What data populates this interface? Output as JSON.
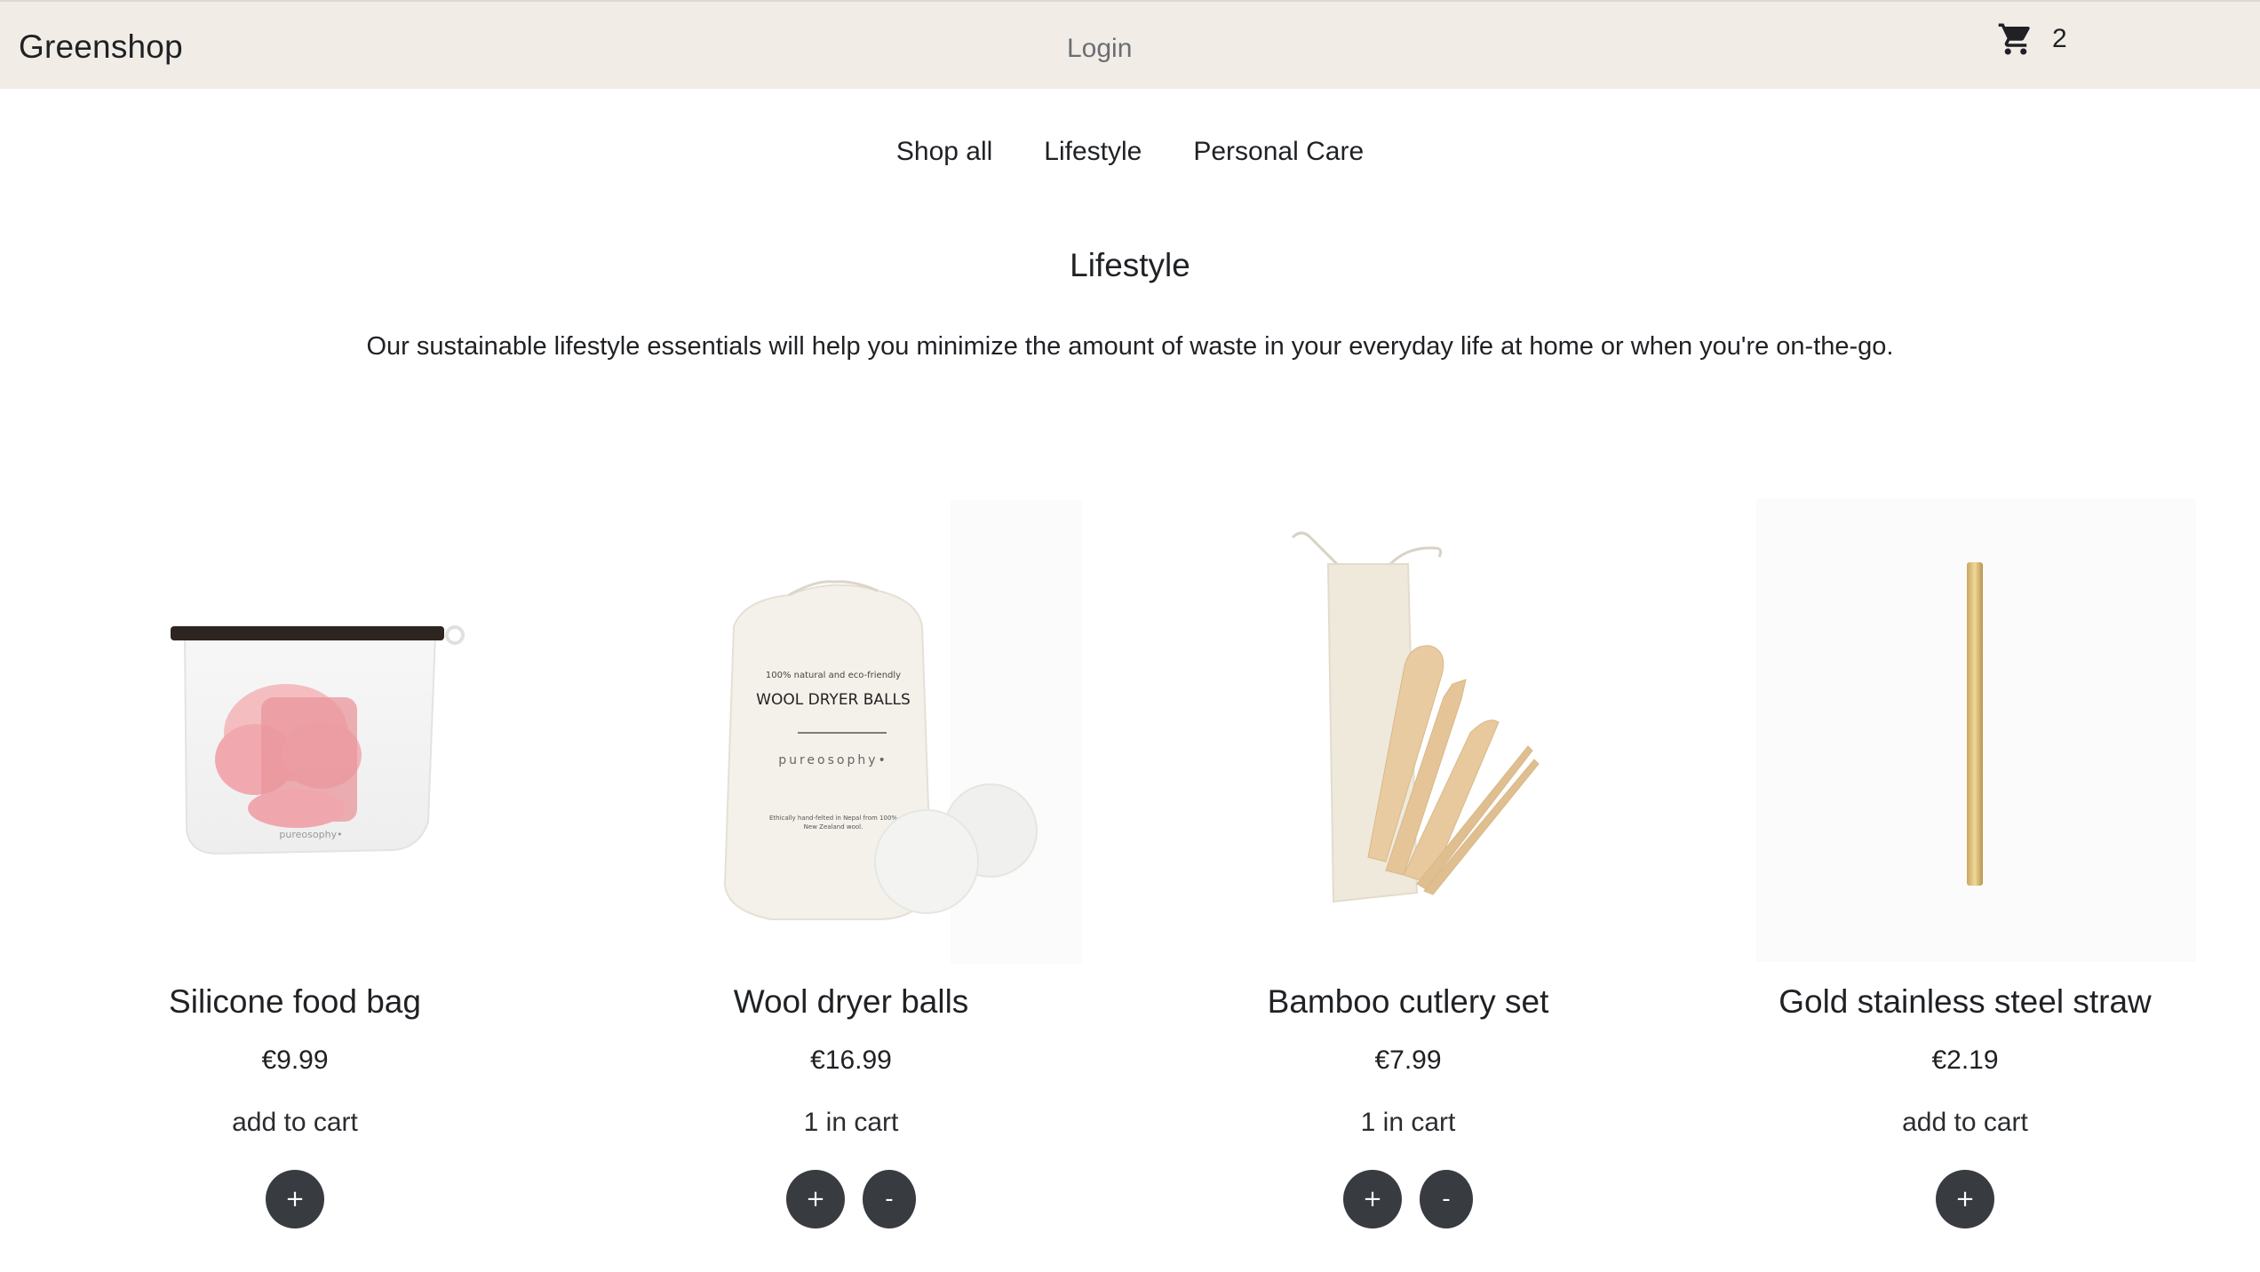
{
  "header": {
    "brand": "Greenshop",
    "login_label": "Login",
    "cart_icon": "shopping-cart-icon",
    "cart_count": "2"
  },
  "nav": {
    "items": [
      {
        "label": "Shop all"
      },
      {
        "label": "Lifestyle"
      },
      {
        "label": "Personal Care"
      }
    ]
  },
  "category": {
    "title": "Lifestyle",
    "description": "Our sustainable lifestyle essentials will help you minimize the amount of waste in your everyday life at home or when you're on-the-go."
  },
  "products": [
    {
      "name": "Silicone food bag",
      "price": "€9.99",
      "status": "add to cart",
      "plus": "+",
      "minus": ""
    },
    {
      "name": "Wool dryer balls",
      "price": "€16.99",
      "status": "1 in cart",
      "plus": "+",
      "minus": "-"
    },
    {
      "name": "Bamboo cutlery set",
      "price": "€7.99",
      "status": "1 in cart",
      "plus": "+",
      "minus": "-"
    },
    {
      "name": "Gold stainless steel straw",
      "price": "€2.19",
      "status": "add to cart",
      "plus": "+",
      "minus": ""
    }
  ],
  "image_text": {
    "bag_brand": "pureosophy•",
    "dryer_small": "100% natural and eco-friendly",
    "dryer_title": "WOOL DRYER BALLS",
    "dryer_brand": "pureosophy•",
    "dryer_footer1": "Ethically hand-felted in Nepal from 100%",
    "dryer_footer2": "New Zealand wool."
  },
  "colors": {
    "header_bg": "#f1ece6",
    "button_bg": "#383b40",
    "text": "#1f2124"
  }
}
